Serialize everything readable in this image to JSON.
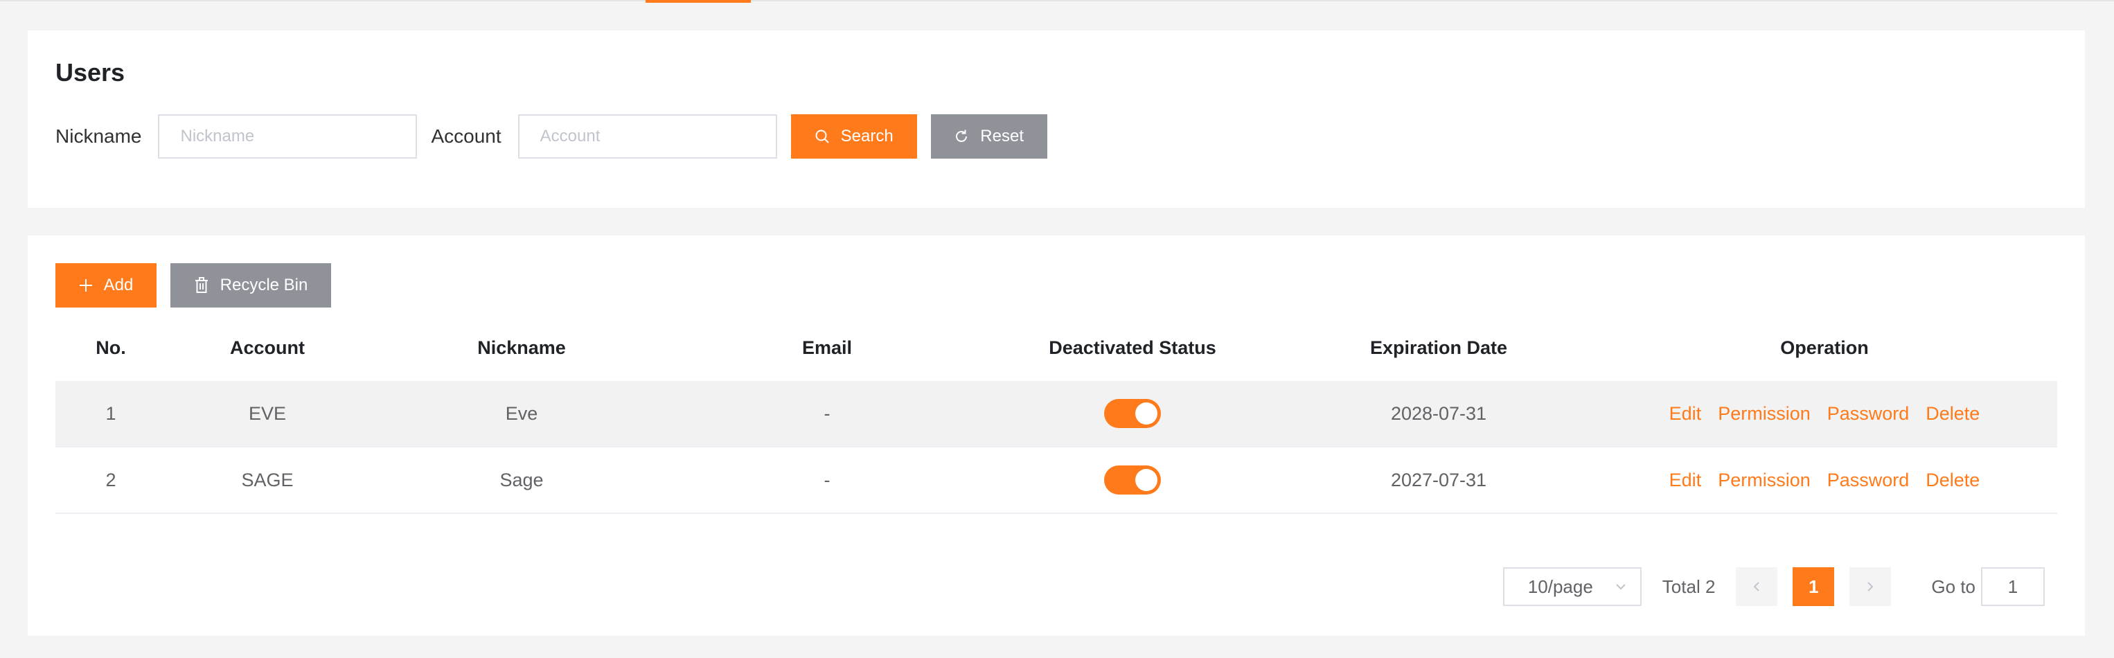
{
  "colors": {
    "accent": "#ff7a1a",
    "gray_button": "#8f9299",
    "page_bg": "#f4f4f5"
  },
  "search": {
    "title": "Users",
    "nickname_label": "Nickname",
    "nickname_placeholder": "Nickname",
    "account_label": "Account",
    "account_placeholder": "Account",
    "search_label": "Search",
    "reset_label": "Reset"
  },
  "toolbar": {
    "add_label": "Add",
    "recycle_label": "Recycle Bin"
  },
  "table": {
    "headers": [
      "No.",
      "Account",
      "Nickname",
      "Email",
      "Deactivated Status",
      "Expiration Date",
      "Operation"
    ],
    "rows": [
      {
        "no": "1",
        "account": "EVE",
        "nickname": "Eve",
        "email": "-",
        "deactivated": true,
        "expiration": "2028-07-31"
      },
      {
        "no": "2",
        "account": "SAGE",
        "nickname": "Sage",
        "email": "-",
        "deactivated": true,
        "expiration": "2027-07-31"
      }
    ],
    "operations": [
      "Edit",
      "Permission",
      "Password",
      "Delete"
    ]
  },
  "pagination": {
    "page_size": "10/page",
    "total": "Total 2",
    "current_page": "1",
    "goto_label": "Go to",
    "goto_value": "1"
  }
}
